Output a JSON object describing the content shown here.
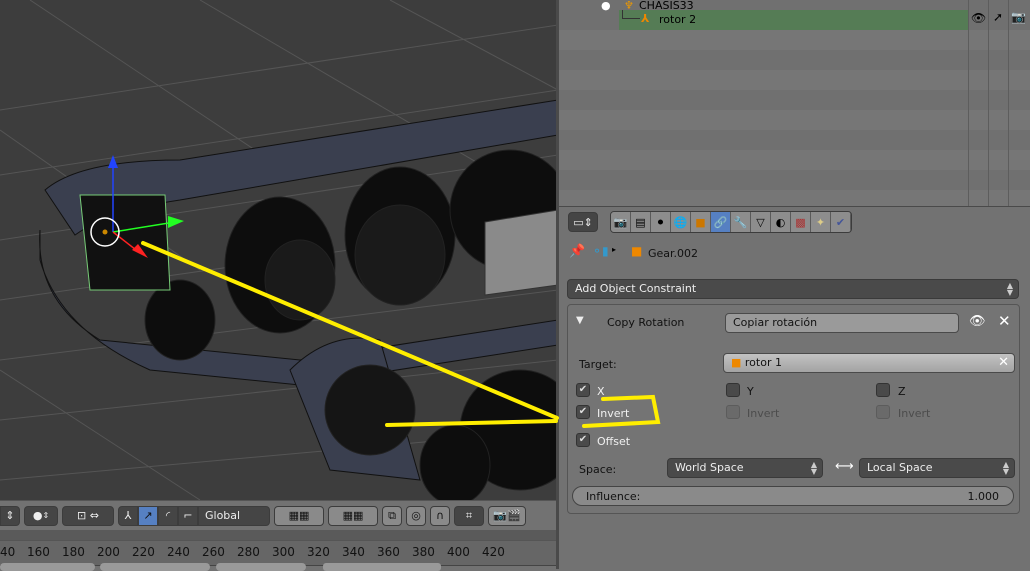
{
  "outliner": {
    "items": [
      {
        "label": "CHASIS33",
        "icon": "armature-icon"
      },
      {
        "label": "rotor 2",
        "icon": "empty-icon",
        "selected": true
      }
    ]
  },
  "viewport_header": {
    "orientation": "Global"
  },
  "timeline": {
    "ticks": [
      "40",
      "160",
      "180",
      "200",
      "220",
      "240",
      "260",
      "280",
      "300",
      "320",
      "340",
      "360",
      "380",
      "400",
      "420"
    ]
  },
  "properties": {
    "object_name": "Gear.002",
    "add_constraint_label": "Add Object Constraint",
    "constraint": {
      "type": "Copy Rotation",
      "name": "Copiar rotación",
      "target_label": "Target:",
      "target": "rotor 1",
      "axes": [
        {
          "label": "X",
          "checked": true,
          "invert_label": "Invert",
          "invert": true
        },
        {
          "label": "Y",
          "checked": false,
          "invert_label": "Invert",
          "invert": false
        },
        {
          "label": "Z",
          "checked": false,
          "invert_label": "Invert",
          "invert": false
        }
      ],
      "offset_label": "Offset",
      "offset": true,
      "space_label": "Space:",
      "owner_space": "World Space",
      "target_space": "Local Space",
      "influence_label": "Influence:",
      "influence": "1.000"
    }
  },
  "colors": {
    "viewport_bg": "#3d3d3d",
    "panel_bg": "#727272",
    "selected_row": "#557c55",
    "active_tab": "#5680c2",
    "annotation": "#ffee00"
  }
}
